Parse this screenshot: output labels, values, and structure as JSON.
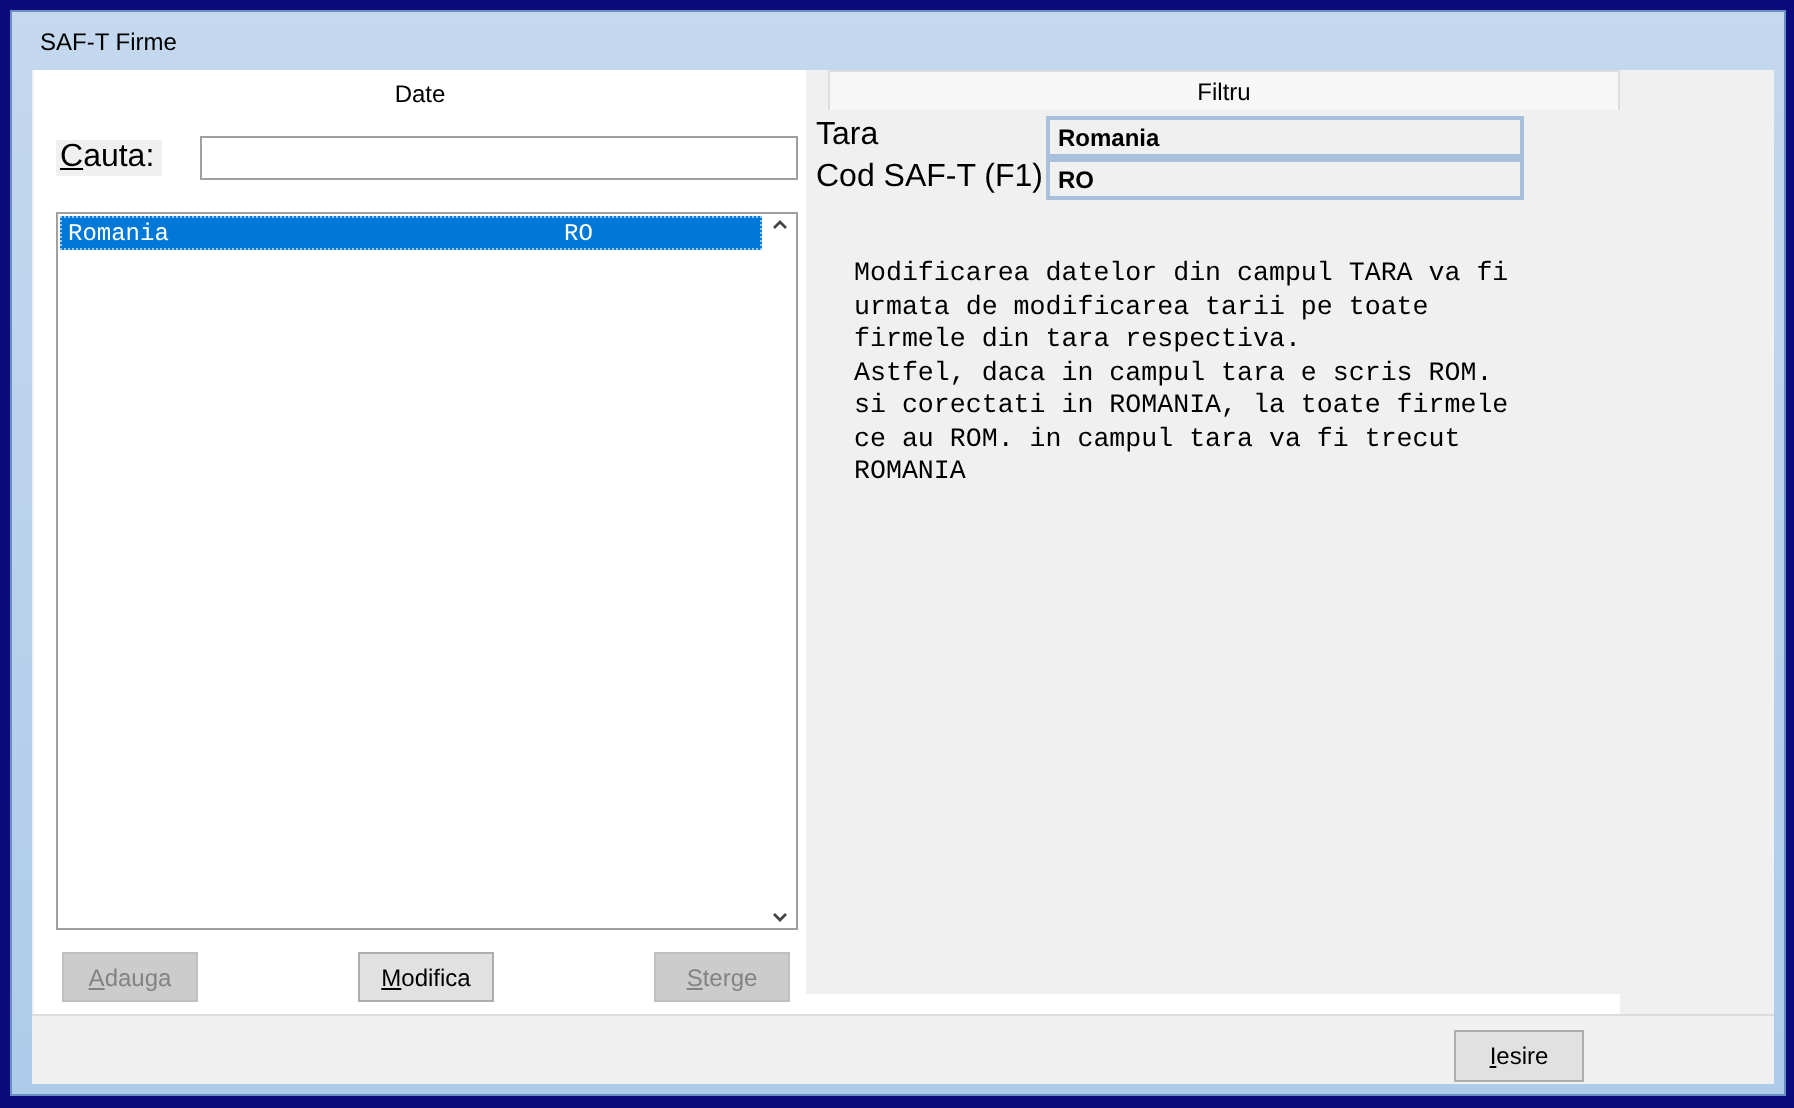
{
  "window": {
    "title": "SAF-T Firme"
  },
  "tabs": [
    {
      "label": "Date",
      "selected": true
    },
    {
      "label": "Filtru",
      "selected": false
    }
  ],
  "search": {
    "label": "Cauta:"
  },
  "list": {
    "rows": [
      {
        "name": "Romania",
        "code": "RO",
        "selected": true
      }
    ]
  },
  "buttons": [
    {
      "label": "Adauga",
      "disabled": true
    },
    {
      "label": "Modifica",
      "disabled": false
    },
    {
      "label": "Sterge",
      "disabled": true
    }
  ],
  "filter": {
    "fields": [
      {
        "label": "Tara",
        "value": "Romania"
      },
      {
        "label": "Cod SAF-T (F1)",
        "value": "RO"
      }
    ],
    "note": [
      "Modificarea datelor din campul TARA va fi",
      "urmata de modificarea tarii pe toate",
      "firmele din tara respectiva.",
      "Astfel, daca in campul tara e scris ROM.",
      "si corectati in ROMANIA, la toate firmele",
      "ce au ROM. in campul tara va fi trecut",
      "ROMANIA"
    ]
  },
  "exit_button": {
    "label": "Iesire",
    "disabled": false
  }
}
